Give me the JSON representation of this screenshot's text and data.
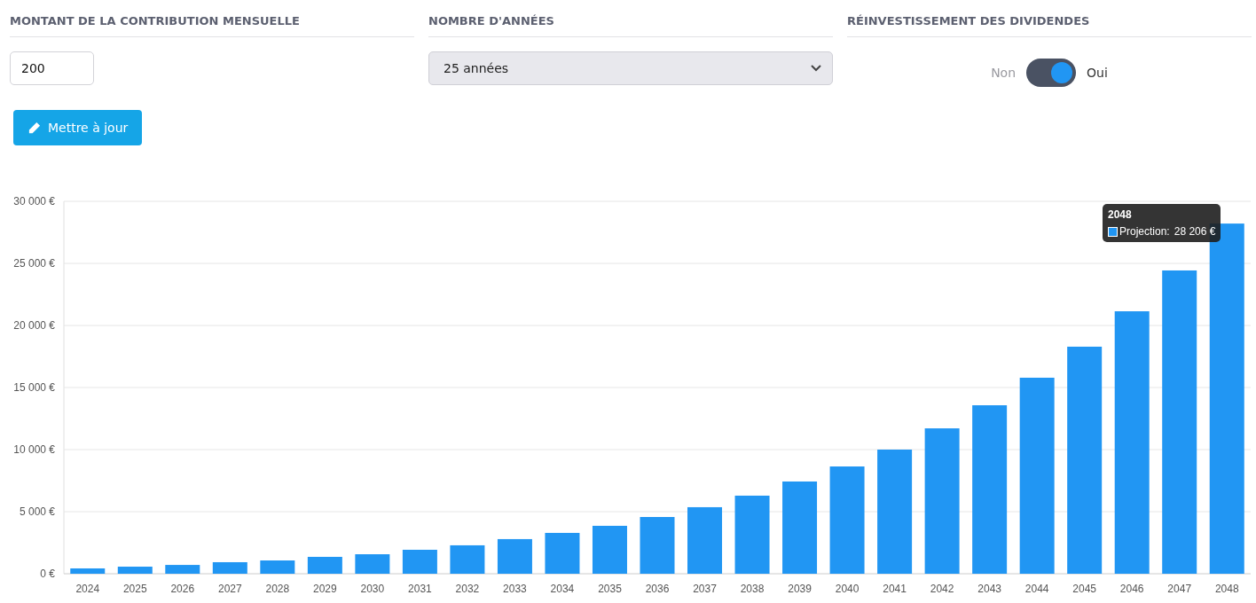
{
  "contribution": {
    "heading": "MONTANT DE LA CONTRIBUTION MENSUELLE",
    "value": "200"
  },
  "years": {
    "heading": "NOMBRE D'ANNÉES",
    "value": "25 années"
  },
  "dividends": {
    "heading": "RÉINVESTISSEMENT DES DIVIDENDES",
    "off_label": "Non",
    "on_label": "Oui",
    "on": true
  },
  "update_button": {
    "label": "Mettre à jour"
  },
  "chart": {
    "tooltip": {
      "title": "2048",
      "value": "28 206 €",
      "color": "#2196f3"
    },
    "chart_data": {
      "type": "bar",
      "grid": true,
      "categories": [
        "2024",
        "2025",
        "2026",
        "2027",
        "2028",
        "2029",
        "2030",
        "2031",
        "2032",
        "2033",
        "2034",
        "2035",
        "2036",
        "2037",
        "2038",
        "2039",
        "2040",
        "2041",
        "2042",
        "2043",
        "2044",
        "2045",
        "2046",
        "2047",
        "2048"
      ],
      "series": [
        {
          "name": "Projection:",
          "color": "#2196f3",
          "values": [
            430,
            570,
            710,
            930,
            1070,
            1360,
            1570,
            1930,
            2290,
            2790,
            3290,
            3860,
            4570,
            5360,
            6290,
            7430,
            8640,
            10000,
            11710,
            13570,
            15790,
            18290,
            21140,
            24430,
            28206
          ]
        }
      ],
      "ylim": [
        0,
        30000
      ],
      "yticks": [
        {
          "value": 0,
          "label": "0 €"
        },
        {
          "value": 5000,
          "label": "5 000 €"
        },
        {
          "value": 10000,
          "label": "10 000 €"
        },
        {
          "value": 15000,
          "label": "15 000 €"
        },
        {
          "value": 20000,
          "label": "20 000 €"
        },
        {
          "value": 25000,
          "label": "25 000 €"
        },
        {
          "value": 30000,
          "label": "30 000 €"
        }
      ]
    }
  }
}
